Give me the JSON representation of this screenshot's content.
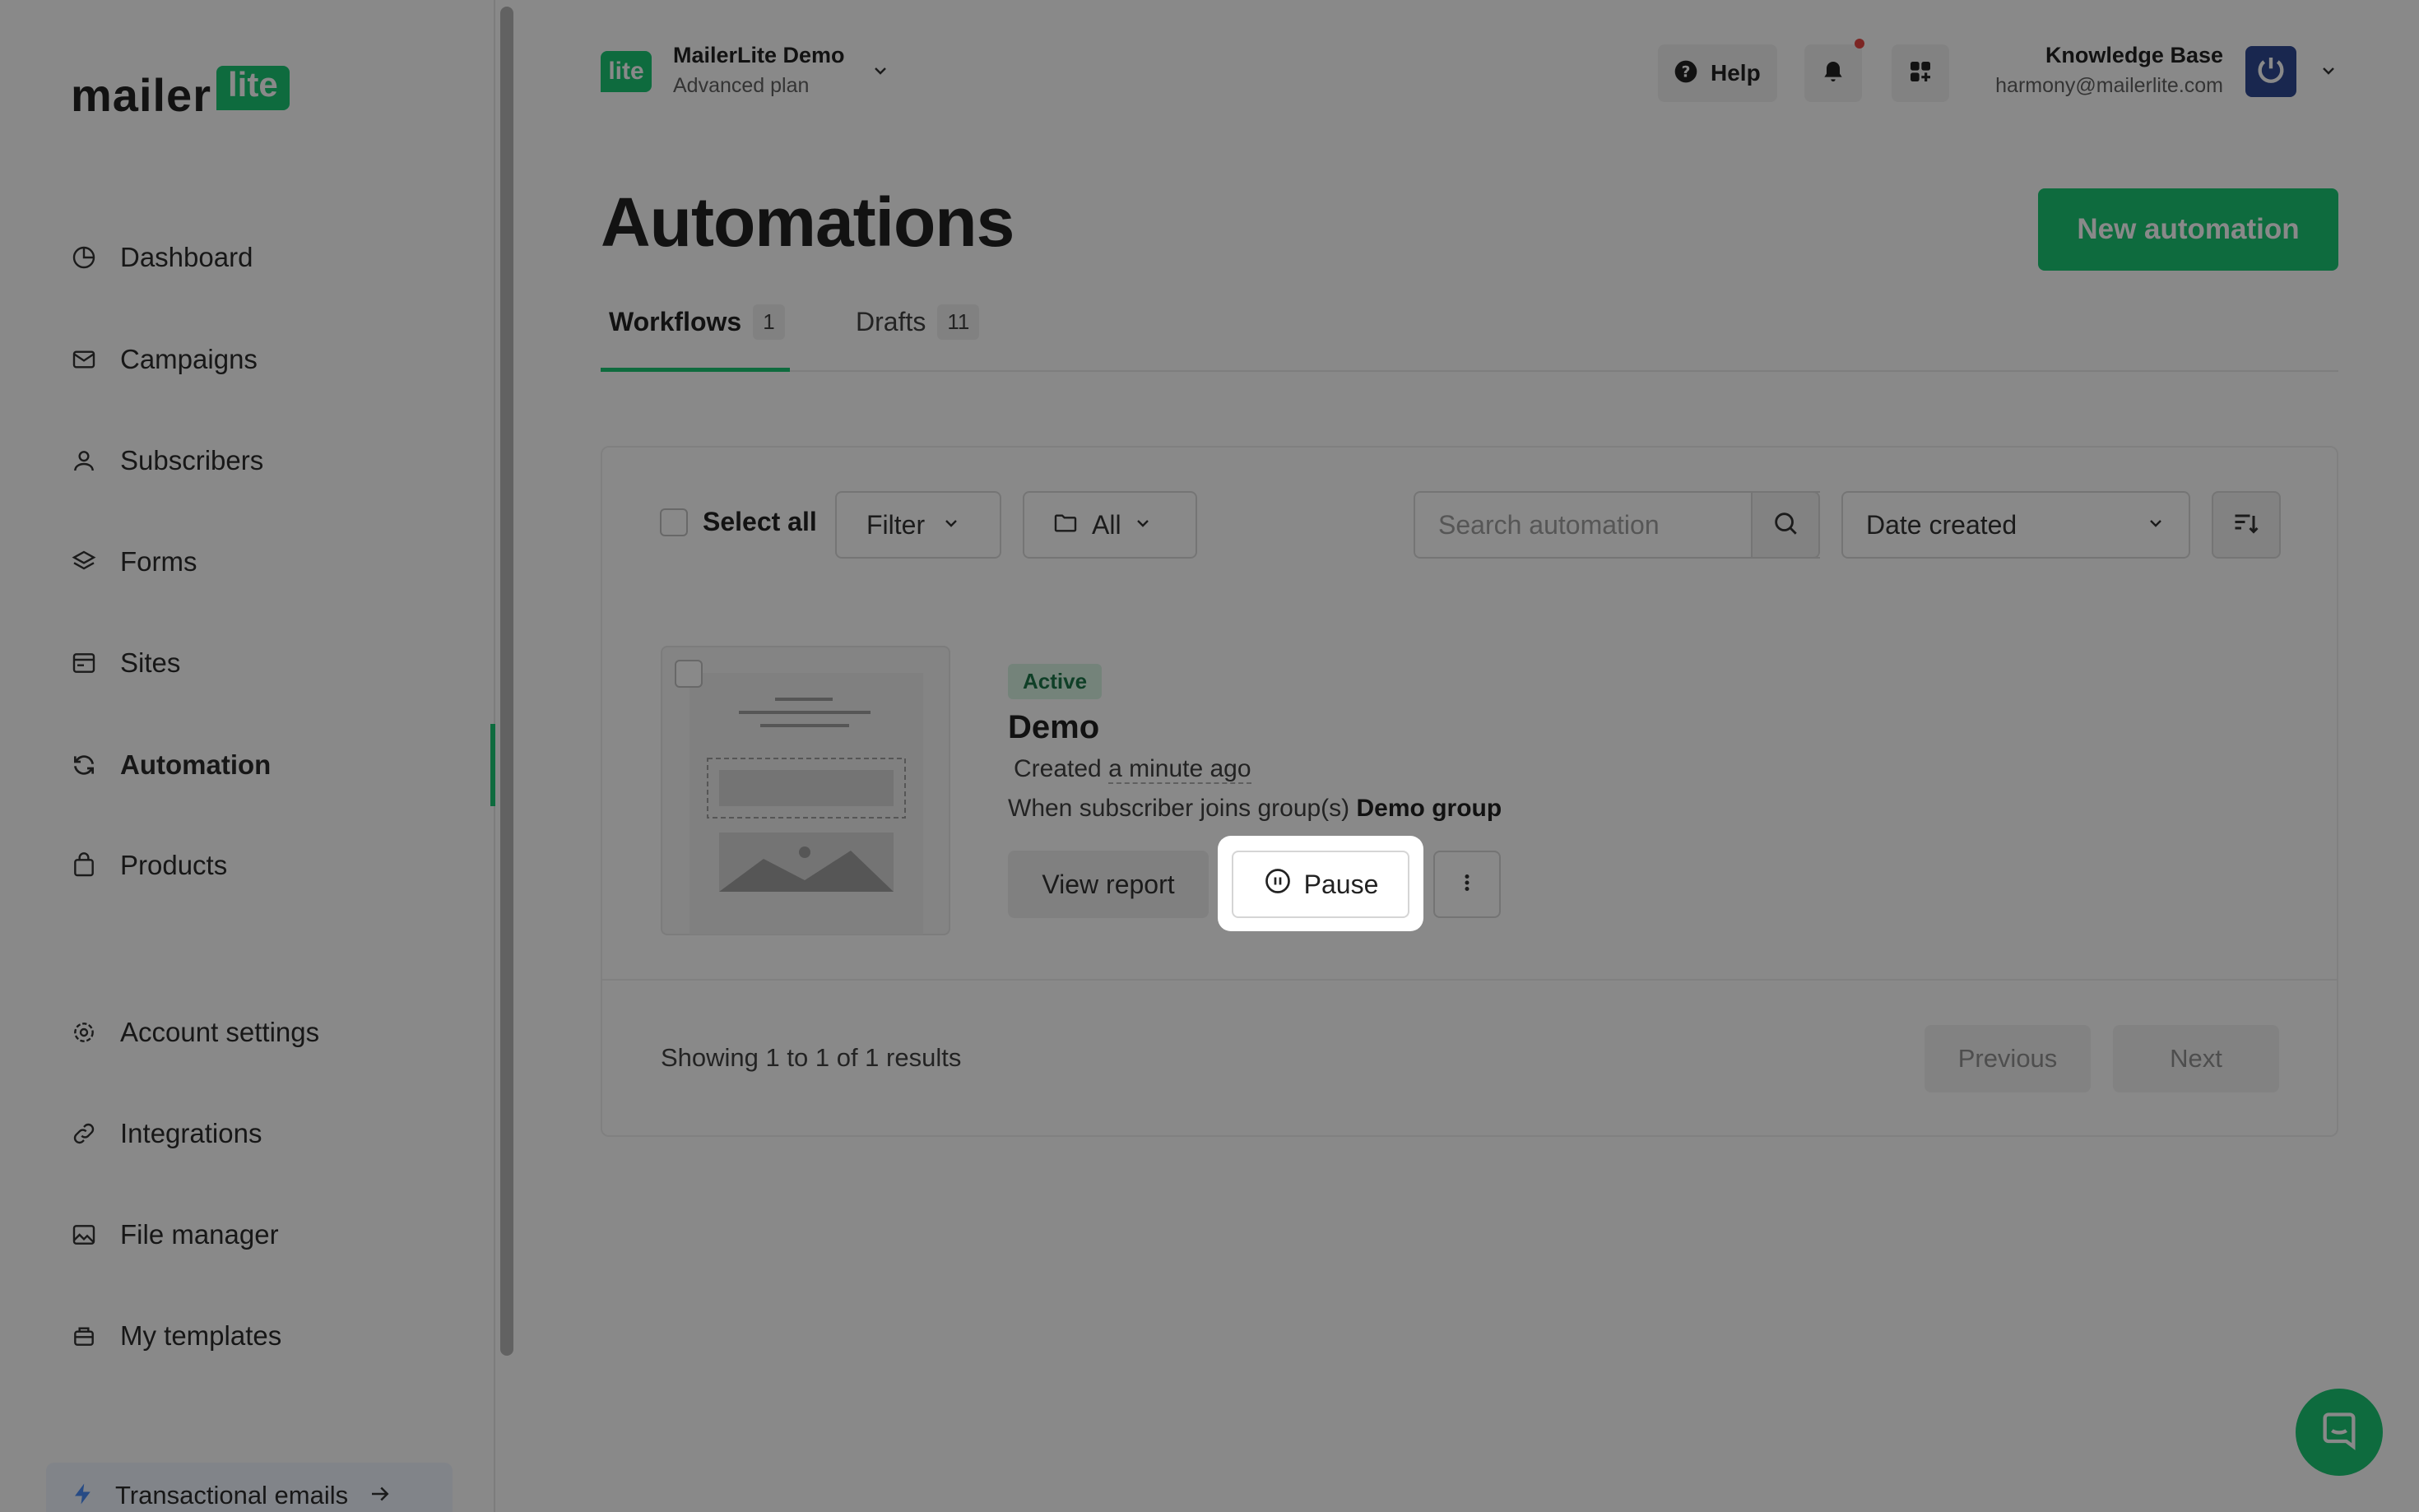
{
  "sidebar": {
    "logo_text": "mailer",
    "logo_badge": "lite",
    "items": [
      {
        "label": "Dashboard",
        "icon": "chart-pie-icon"
      },
      {
        "label": "Campaigns",
        "icon": "envelope-icon"
      },
      {
        "label": "Subscribers",
        "icon": "user-icon"
      },
      {
        "label": "Forms",
        "icon": "layers-icon"
      },
      {
        "label": "Sites",
        "icon": "browser-icon"
      },
      {
        "label": "Automation",
        "icon": "refresh-icon",
        "active": true
      },
      {
        "label": "Products",
        "icon": "shopping-bag-icon"
      },
      {
        "label": "Account settings",
        "icon": "gear-icon"
      },
      {
        "label": "Integrations",
        "icon": "link-icon"
      },
      {
        "label": "File manager",
        "icon": "image-icon"
      },
      {
        "label": "My templates",
        "icon": "briefcase-icon"
      }
    ],
    "transactional": {
      "label": "Transactional emails",
      "icon": "lightning-icon"
    }
  },
  "header": {
    "account_logo": "lite",
    "account_name": "MailerLite Demo",
    "account_plan": "Advanced plan",
    "help_label": "Help",
    "user_name": "Knowledge Base",
    "user_email": "harmony@mailerlite.com"
  },
  "main": {
    "title": "Automations",
    "new_button": "New automation",
    "tabs": [
      {
        "label": "Workflows",
        "count": "1",
        "active": true
      },
      {
        "label": "Drafts",
        "count": "11",
        "active": false
      }
    ],
    "toolbar": {
      "select_all": "Select all",
      "filter": "Filter",
      "folder": "All",
      "search_placeholder": "Search automation",
      "sort": "Date created"
    },
    "workflow": {
      "status": "Active",
      "name": "Demo",
      "created_prefix": "Created",
      "created_when": "a minute ago",
      "trigger_prefix": "When subscriber joins group(s)",
      "trigger_group": "Demo group",
      "view_report": "View report",
      "pause": "Pause"
    },
    "pagination": {
      "showing": "Showing 1 to 1 of 1 results",
      "previous": "Previous",
      "next": "Next"
    }
  },
  "colors": {
    "accent": "#09c269",
    "avatar": "#1e3a8a",
    "notification_dot": "#e53935"
  }
}
